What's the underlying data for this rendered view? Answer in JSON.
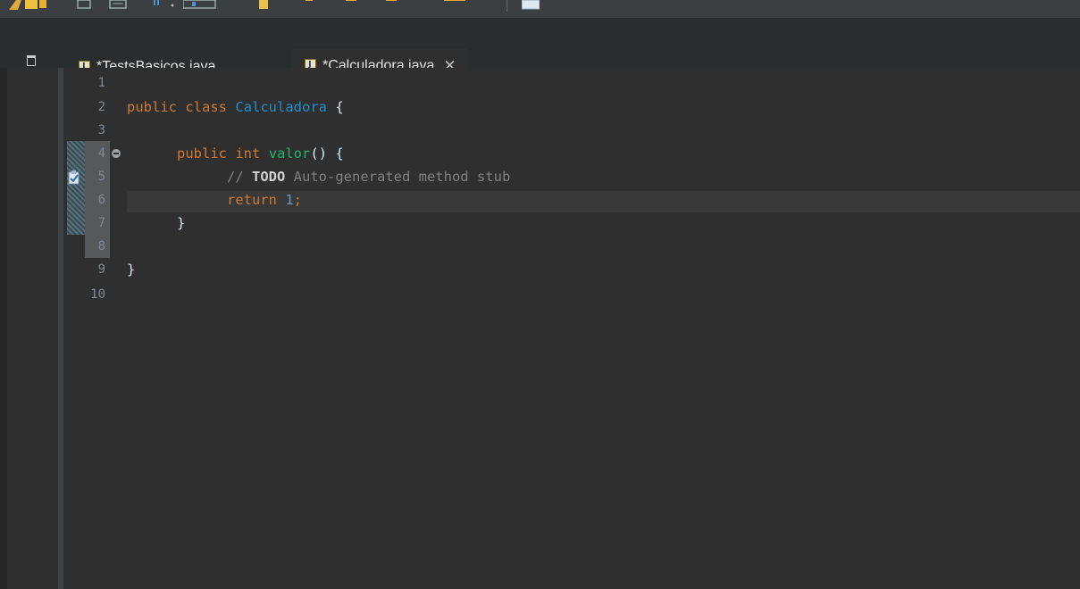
{
  "tabs": [
    {
      "label": "*TestsBasicos.java",
      "active": false
    },
    {
      "label": "*Calculadora.java",
      "active": true
    }
  ],
  "editor": {
    "line_numbers": [
      "1",
      "2",
      "3",
      "4",
      "5",
      "6",
      "7",
      "8",
      "9",
      "10"
    ],
    "code": {
      "l2_kw_public": "public",
      "l2_kw_class": "class",
      "l2_classname": "Calculadora",
      "l2_brace": "{",
      "l4_kw_public": "public",
      "l4_kw_int": "int",
      "l4_method": "valor",
      "l4_rest": "() {",
      "l5_slashes": "//",
      "l5_todo": "TODO",
      "l5_comment": "Auto-generated method stub",
      "l6_kw_return": "return",
      "l6_num": "1",
      "l6_semi": ";",
      "l7_brace": "}",
      "l9_brace": "}"
    }
  },
  "icons": {
    "tab_close": "close-icon",
    "file_type": "java-file-icon",
    "minimize": "minimize-icon",
    "fold": "fold-collapse-icon",
    "task": "task-marker-icon"
  },
  "colors": {
    "background": "#2f2f2f",
    "keyword": "#cc7832",
    "class_name": "#1e90c8",
    "method": "#1fb36a",
    "number": "#6897bb",
    "comment": "#808080",
    "active_tab_underline": "#3f8fd6"
  }
}
